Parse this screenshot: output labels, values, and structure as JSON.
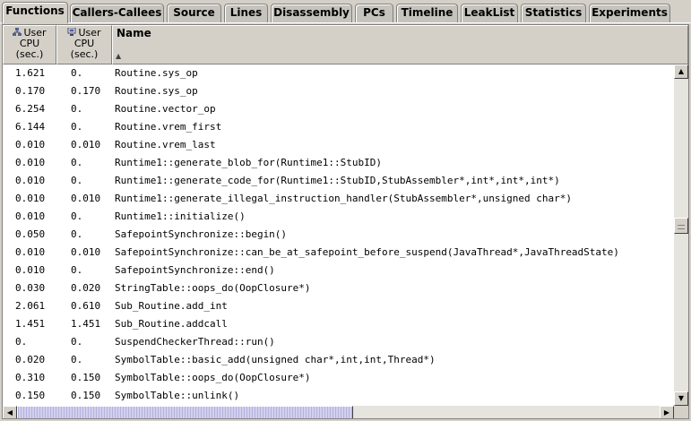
{
  "tabs": [
    {
      "label": "Functions",
      "active": true
    },
    {
      "label": "Callers-Callees",
      "active": false
    },
    {
      "label": "Source",
      "active": false
    },
    {
      "label": "Lines",
      "active": false
    },
    {
      "label": "Disassembly",
      "active": false
    },
    {
      "label": "PCs",
      "active": false
    },
    {
      "label": "Timeline",
      "active": false
    },
    {
      "label": "LeakList",
      "active": false
    },
    {
      "label": "Statistics",
      "active": false
    },
    {
      "label": "Experiments",
      "active": false
    }
  ],
  "table": {
    "columns": [
      {
        "label_line1": "User",
        "label_line2": "CPU",
        "label_line3": "(sec.)",
        "icon": "exclusive-metric-icon"
      },
      {
        "label_line1": "User",
        "label_line2": "CPU",
        "label_line3": "(sec.)",
        "icon": "inclusive-metric-icon"
      },
      {
        "label": "Name",
        "sort_indicator": "▲"
      }
    ],
    "rows": [
      [
        "1.621",
        "0.",
        "Routine.sys_op"
      ],
      [
        "0.170",
        "0.170",
        "Routine.sys_op"
      ],
      [
        "6.254",
        "0.",
        "Routine.vector_op"
      ],
      [
        "6.144",
        "0.",
        "Routine.vrem_first"
      ],
      [
        "0.010",
        "0.010",
        "Routine.vrem_last"
      ],
      [
        "0.010",
        "0.",
        "Runtime1::generate_blob_for(Runtime1::StubID)"
      ],
      [
        "0.010",
        "0.",
        "Runtime1::generate_code_for(Runtime1::StubID,StubAssembler*,int*,int*,int*)"
      ],
      [
        "0.010",
        "0.010",
        "Runtime1::generate_illegal_instruction_handler(StubAssembler*,unsigned char*)"
      ],
      [
        "0.010",
        "0.",
        "Runtime1::initialize()"
      ],
      [
        "0.050",
        "0.",
        "SafepointSynchronize::begin()"
      ],
      [
        "0.010",
        "0.010",
        "SafepointSynchronize::can_be_at_safepoint_before_suspend(JavaThread*,JavaThreadState)"
      ],
      [
        "0.010",
        "0.",
        "SafepointSynchronize::end()"
      ],
      [
        "0.030",
        "0.020",
        "StringTable::oops_do(OopClosure*)"
      ],
      [
        "2.061",
        "0.610",
        "Sub_Routine.add_int"
      ],
      [
        "1.451",
        "1.451",
        "Sub_Routine.addcall"
      ],
      [
        "0.",
        "0.",
        "SuspendCheckerThread::run()"
      ],
      [
        "0.020",
        "0.",
        "SymbolTable::basic_add(unsigned char*,int,int,Thread*)"
      ],
      [
        "0.310",
        "0.150",
        "SymbolTable::oops_do(OopClosure*)"
      ],
      [
        "0.150",
        "0.150",
        "SymbolTable::unlink()"
      ]
    ]
  },
  "scrollbars": {
    "up_arrow": "▲",
    "down_arrow": "▼",
    "left_arrow": "◀",
    "right_arrow": "▶"
  }
}
